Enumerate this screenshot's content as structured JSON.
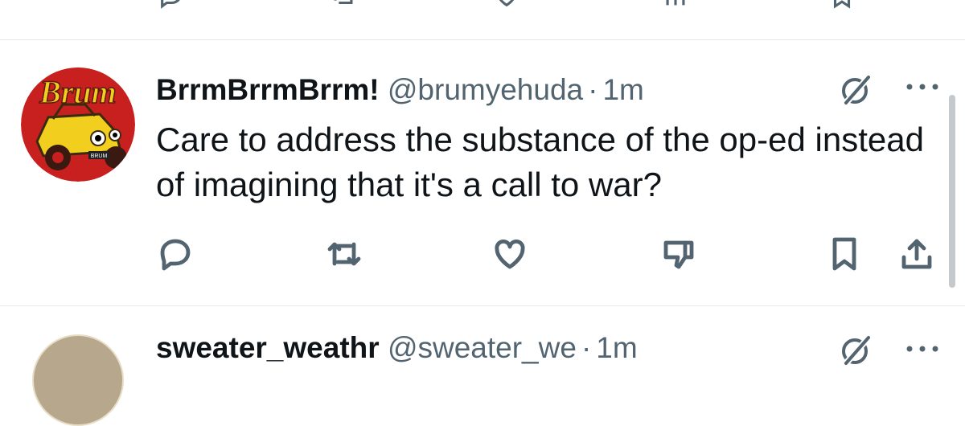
{
  "colors": {
    "text_primary": "#0f1419",
    "text_secondary": "#536471",
    "divider": "#e6e9ec",
    "avatar_red": "#c8201e",
    "avatar_yellow": "#f2cf1f"
  },
  "top_actions": {
    "icons": [
      "reply-icon",
      "retweet-icon",
      "like-icon",
      "analytics-icon",
      "bookmark-icon"
    ]
  },
  "tweet": {
    "display_name": "BrrmBrrmBrrm!",
    "handle": "@brumyehuda",
    "separator": "·",
    "time": "1m",
    "text": "Care to address the substance of the op-ed instead of imagining that it's a call to war?",
    "avatar": {
      "logo_text": "Brum",
      "plate_text": "BRUM"
    },
    "actions": [
      "reply-icon",
      "retweet-icon",
      "like-icon",
      "dislike-icon",
      "bookmark-icon",
      "share-icon"
    ]
  },
  "next_tweet": {
    "display_name": "sweater_weathr",
    "handle": "@sweater_we",
    "separator": "·",
    "time": "1m"
  }
}
